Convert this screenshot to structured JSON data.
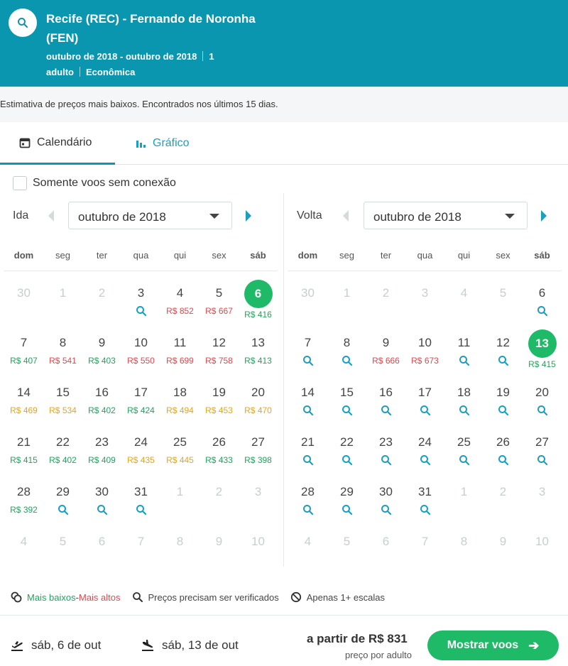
{
  "header": {
    "route": "Recife (REC) - Fernando de Noronha (FEN)",
    "period": "outubro de 2018 - outubro de 2018",
    "passengers": "1 adulto",
    "cabin": "Econômica"
  },
  "notice": "Estimativa de preços mais baixos. Encontrados nos últimos 15 dias.",
  "tabs": {
    "calendar": "Calendário",
    "chart": "Gráfico"
  },
  "nonstop_label": "Somente voos sem conexão",
  "weekdays": [
    "dom",
    "seg",
    "ter",
    "qua",
    "qui",
    "sex",
    "sáb"
  ],
  "outbound": {
    "label": "Ida",
    "month": "outubro de 2018",
    "days": [
      {
        "n": "30",
        "o": 1
      },
      {
        "n": "1",
        "o": 1
      },
      {
        "n": "2",
        "o": 1
      },
      {
        "n": "3",
        "s": 1
      },
      {
        "n": "4",
        "p": "R$ 852",
        "c": "red"
      },
      {
        "n": "5",
        "p": "R$ 667",
        "c": "red"
      },
      {
        "n": "6",
        "p": "R$ 416",
        "c": "green",
        "sel": 1
      },
      {
        "n": "7",
        "p": "R$ 407",
        "c": "green"
      },
      {
        "n": "8",
        "p": "R$ 541",
        "c": "red"
      },
      {
        "n": "9",
        "p": "R$ 403",
        "c": "green"
      },
      {
        "n": "10",
        "p": "R$ 550",
        "c": "red"
      },
      {
        "n": "11",
        "p": "R$ 699",
        "c": "red"
      },
      {
        "n": "12",
        "p": "R$ 758",
        "c": "red"
      },
      {
        "n": "13",
        "p": "R$ 413",
        "c": "green"
      },
      {
        "n": "14",
        "p": "R$ 469",
        "c": "orange"
      },
      {
        "n": "15",
        "p": "R$ 534",
        "c": "orange"
      },
      {
        "n": "16",
        "p": "R$ 402",
        "c": "green"
      },
      {
        "n": "17",
        "p": "R$ 424",
        "c": "green"
      },
      {
        "n": "18",
        "p": "R$ 494",
        "c": "orange"
      },
      {
        "n": "19",
        "p": "R$ 453",
        "c": "orange"
      },
      {
        "n": "20",
        "p": "R$ 470",
        "c": "orange"
      },
      {
        "n": "21",
        "p": "R$ 415",
        "c": "green"
      },
      {
        "n": "22",
        "p": "R$ 402",
        "c": "green"
      },
      {
        "n": "23",
        "p": "R$ 409",
        "c": "green"
      },
      {
        "n": "24",
        "p": "R$ 435",
        "c": "orange"
      },
      {
        "n": "25",
        "p": "R$ 445",
        "c": "orange"
      },
      {
        "n": "26",
        "p": "R$ 433",
        "c": "green"
      },
      {
        "n": "27",
        "p": "R$ 398",
        "c": "green"
      },
      {
        "n": "28",
        "p": "R$ 392",
        "c": "green"
      },
      {
        "n": "29",
        "s": 1
      },
      {
        "n": "30",
        "s": 1
      },
      {
        "n": "31",
        "s": 1
      },
      {
        "n": "1",
        "o": 1
      },
      {
        "n": "2",
        "o": 1
      },
      {
        "n": "3",
        "o": 1
      },
      {
        "n": "4",
        "o": 1
      },
      {
        "n": "5",
        "o": 1
      },
      {
        "n": "6",
        "o": 1
      },
      {
        "n": "7",
        "o": 1
      },
      {
        "n": "8",
        "o": 1
      },
      {
        "n": "9",
        "o": 1
      },
      {
        "n": "10",
        "o": 1
      }
    ]
  },
  "inbound": {
    "label": "Volta",
    "month": "outubro de 2018",
    "days": [
      {
        "n": "30",
        "o": 1
      },
      {
        "n": "1",
        "o": 1
      },
      {
        "n": "2",
        "o": 1
      },
      {
        "n": "3",
        "o": 1
      },
      {
        "n": "4",
        "o": 1
      },
      {
        "n": "5",
        "o": 1
      },
      {
        "n": "6",
        "s": 1
      },
      {
        "n": "7",
        "s": 1
      },
      {
        "n": "8",
        "s": 1
      },
      {
        "n": "9",
        "p": "R$ 666",
        "c": "red"
      },
      {
        "n": "10",
        "p": "R$ 673",
        "c": "red"
      },
      {
        "n": "11",
        "s": 1
      },
      {
        "n": "12",
        "s": 1
      },
      {
        "n": "13",
        "p": "R$ 415",
        "c": "green",
        "sel": 1
      },
      {
        "n": "14",
        "s": 1
      },
      {
        "n": "15",
        "s": 1
      },
      {
        "n": "16",
        "s": 1
      },
      {
        "n": "17",
        "s": 1
      },
      {
        "n": "18",
        "s": 1
      },
      {
        "n": "19",
        "s": 1
      },
      {
        "n": "20",
        "s": 1
      },
      {
        "n": "21",
        "s": 1
      },
      {
        "n": "22",
        "s": 1
      },
      {
        "n": "23",
        "s": 1
      },
      {
        "n": "24",
        "s": 1
      },
      {
        "n": "25",
        "s": 1
      },
      {
        "n": "26",
        "s": 1
      },
      {
        "n": "27",
        "s": 1
      },
      {
        "n": "28",
        "s": 1
      },
      {
        "n": "29",
        "s": 1
      },
      {
        "n": "30",
        "s": 1
      },
      {
        "n": "31",
        "s": 1
      },
      {
        "n": "1",
        "o": 1
      },
      {
        "n": "2",
        "o": 1
      },
      {
        "n": "3",
        "o": 1
      },
      {
        "n": "4",
        "o": 1
      },
      {
        "n": "5",
        "o": 1
      },
      {
        "n": "6",
        "o": 1
      },
      {
        "n": "7",
        "o": 1
      },
      {
        "n": "8",
        "o": 1
      },
      {
        "n": "9",
        "o": 1
      },
      {
        "n": "10",
        "o": 1
      }
    ]
  },
  "legend": {
    "low": "Mais baixos",
    "dash": " - ",
    "high": "Mais altos",
    "verify": "Preços precisam ser verificados",
    "stops": "Apenas 1+ escalas"
  },
  "footer": {
    "out_date": "sáb, 6 de out",
    "back_date": "sáb, 13 de out",
    "from_price": "a partir de R$ 831",
    "per_adult": "preço por adulto",
    "button": "Mostrar voos"
  },
  "colors": {
    "brand": "#0b96b0",
    "green": "#1fba67",
    "red": "#e0474c",
    "orange": "#e6a519",
    "link": "#1a9fc0"
  },
  "icons": [
    "search-icon",
    "calendar-icon",
    "bar-chart-icon",
    "chevron-left-icon",
    "chevron-right-icon",
    "caret-down-icon",
    "coins-icon",
    "no-entry-icon",
    "plane-takeoff-icon",
    "plane-landing-icon",
    "arrow-right-icon"
  ]
}
